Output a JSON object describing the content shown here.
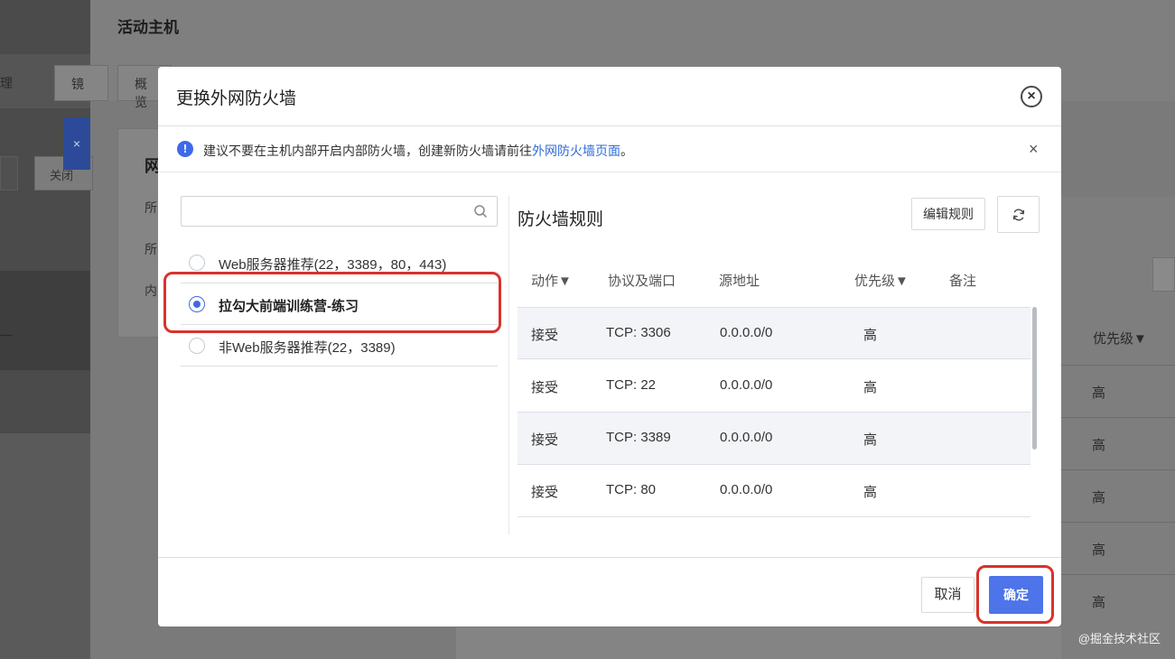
{
  "background": {
    "page_title": "活动主机",
    "tabs": [
      "概览"
    ],
    "left_texts": [
      "理",
      "镜",
      "关闭",
      "所",
      "所",
      "内",
      "一"
    ],
    "panel_title": "网",
    "right_column_header": "优先级▼",
    "right_column_values": [
      "高",
      "高",
      "高",
      "高",
      "高"
    ]
  },
  "modal": {
    "title": "更换外网防火墙",
    "close_icon": "close-circle-icon",
    "notice": {
      "icon": "info-icon",
      "text_before": "建议不要在主机内部开启内部防火墙，创建新防火墙请前往",
      "link_text": "外网防火墙页面",
      "text_after": "。",
      "close_symbol": "×"
    },
    "search": {
      "placeholder": "",
      "value": "",
      "icon": "search-icon"
    },
    "firewall_options": [
      {
        "label": "Web服务器推荐(22，3389，80，443)",
        "checked": false
      },
      {
        "label": "拉勾大前端训练营-练习",
        "checked": true
      },
      {
        "label": "非Web服务器推荐(22，3389)",
        "checked": false
      }
    ],
    "rules": {
      "title": "防火墙规则",
      "edit_button": "编辑规则",
      "refresh_icon": "refresh-icon",
      "columns": [
        "动作▼",
        "协议及端口",
        "源地址",
        "优先级▼",
        "备注"
      ],
      "rows": [
        {
          "action": "接受",
          "protocol": "TCP: 3306",
          "source": "0.0.0.0/0",
          "priority": "高",
          "note": ""
        },
        {
          "action": "接受",
          "protocol": "TCP: 22",
          "source": "0.0.0.0/0",
          "priority": "高",
          "note": ""
        },
        {
          "action": "接受",
          "protocol": "TCP: 3389",
          "source": "0.0.0.0/0",
          "priority": "高",
          "note": ""
        },
        {
          "action": "接受",
          "protocol": "TCP: 80",
          "source": "0.0.0.0/0",
          "priority": "高",
          "note": ""
        }
      ]
    },
    "footer": {
      "cancel": "取消",
      "confirm": "确定"
    }
  },
  "watermark": "@掘金技术社区",
  "colors": {
    "accent": "#4d74e8",
    "link": "#2f6bdb",
    "highlight": "#d9322b",
    "info": "#3f6ae8"
  }
}
